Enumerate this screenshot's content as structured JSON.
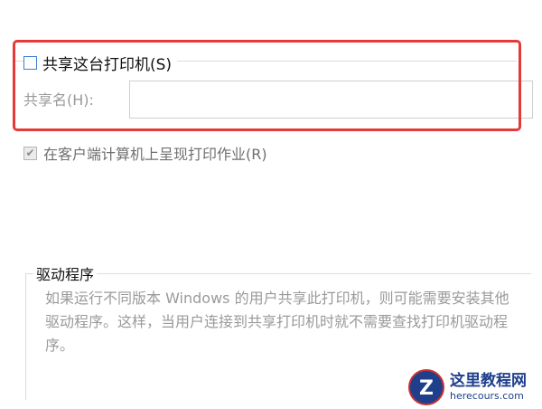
{
  "share": {
    "checkbox_label": "共享这台打印机(S)",
    "checked": false,
    "name_label": "共享名(H):",
    "name_value": ""
  },
  "render": {
    "checkbox_label": "在客户端计算机上呈现打印作业(R)",
    "checked": true
  },
  "driver": {
    "title": "驱动程序",
    "description": "如果运行不同版本 Windows 的用户共享此打印机，则可能需要安装其他驱动程序。这样，当用户连接到共享打印机时就不需要查找打印机驱动程序。"
  },
  "watermark": {
    "badge": "Z",
    "title": "这里教程网",
    "url": "herecours.com"
  },
  "colors": {
    "highlight": "#e43a3a",
    "checkbox_border": "#3f7fc9",
    "watermark": "#1f3f8c"
  }
}
